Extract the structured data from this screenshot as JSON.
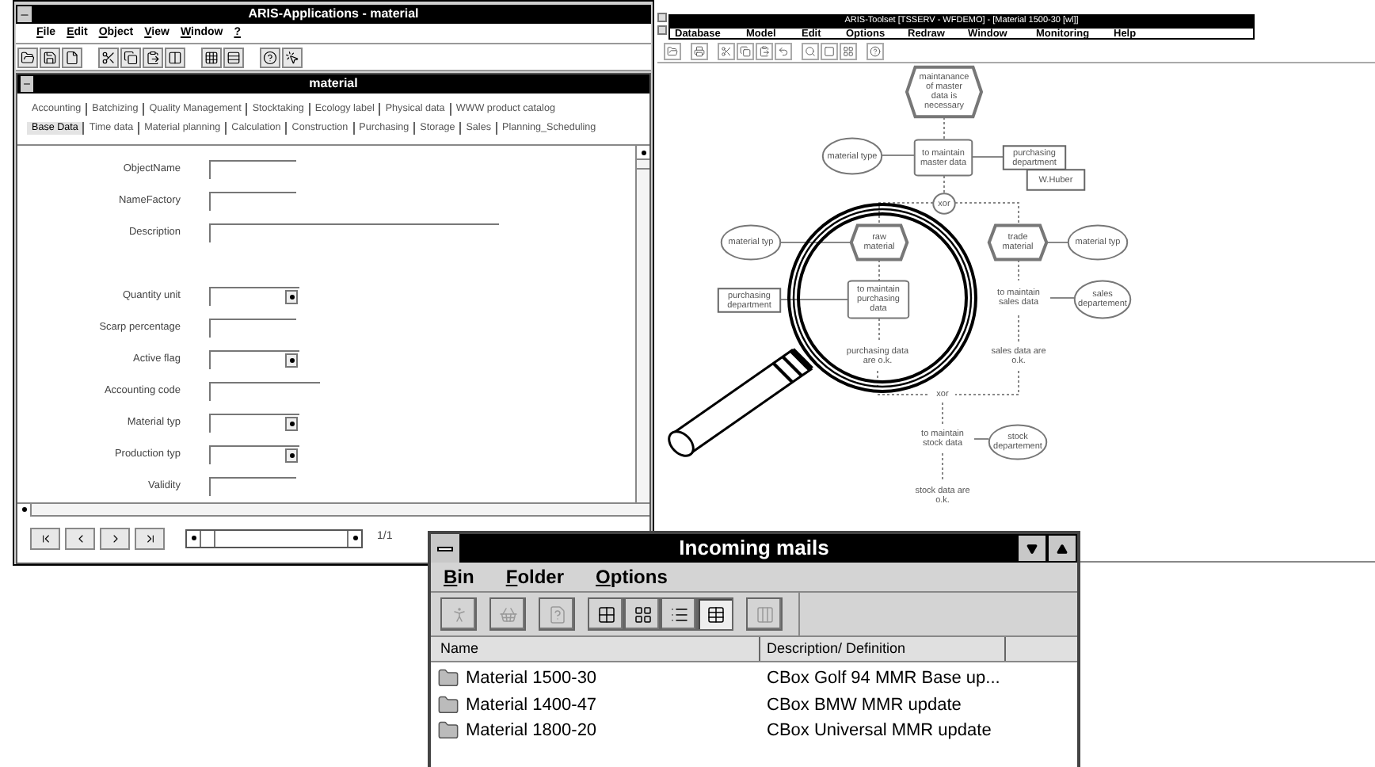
{
  "left_window": {
    "title": "ARIS-Applications - material",
    "menu": [
      "File",
      "Edit",
      "Object",
      "View",
      "Window",
      "?"
    ],
    "document": {
      "title": "material",
      "tab_rows": [
        [
          {
            "label": "Accounting",
            "selected": false
          },
          {
            "label": "Batchizing",
            "selected": false
          },
          {
            "label": "Quality Management",
            "selected": false
          },
          {
            "label": "Stocktaking",
            "selected": false
          },
          {
            "label": "Ecology label",
            "selected": false
          },
          {
            "label": "Physical data",
            "selected": false
          },
          {
            "label": "WWW product catalog",
            "selected": false
          }
        ],
        [
          {
            "label": "Base Data",
            "selected": true
          },
          {
            "label": "Time data",
            "selected": false
          },
          {
            "label": "Material planning",
            "selected": false
          },
          {
            "label": "Calculation",
            "selected": false
          },
          {
            "label": "Construction",
            "selected": false
          },
          {
            "label": "Purchasing",
            "selected": false
          },
          {
            "label": "Storage",
            "selected": false
          },
          {
            "label": "Sales",
            "selected": false
          },
          {
            "label": "Planning_Scheduling",
            "selected": false
          }
        ]
      ],
      "fields": [
        {
          "label": "ObjectName",
          "kind": "short"
        },
        {
          "label": "NameFactory",
          "kind": "short"
        },
        {
          "label": "Description",
          "kind": "long"
        },
        {
          "label": "Quantity unit",
          "kind": "select"
        },
        {
          "label": "Scarp percentage",
          "kind": "short"
        },
        {
          "label": "Active flag",
          "kind": "select"
        },
        {
          "label": "Accounting code",
          "kind": "medium"
        },
        {
          "label": "Material typ",
          "kind": "select"
        },
        {
          "label": "Production typ",
          "kind": "select"
        },
        {
          "label": "Validity",
          "kind": "short"
        }
      ],
      "pager": "1/1"
    }
  },
  "right_window": {
    "title": "ARIS-Toolset [TSSERV - WFDEMO] - [Material 1500-30 [wl]]",
    "menu": [
      "Database",
      "Model",
      "Edit",
      "Options",
      "Redraw",
      "Window",
      "Monitoring",
      "Help"
    ],
    "diagram": {
      "nodes": [
        {
          "kind": "event",
          "text": "maintanance of master data is necessary"
        },
        {
          "kind": "entity",
          "text": "material type"
        },
        {
          "kind": "function",
          "text": "to maintain master data"
        },
        {
          "kind": "org",
          "text": "purchasing department"
        },
        {
          "kind": "org",
          "text": "W.Huber"
        },
        {
          "kind": "xor",
          "text": "xor"
        },
        {
          "kind": "entity",
          "text": "material typ"
        },
        {
          "kind": "event",
          "text": "raw material"
        },
        {
          "kind": "event",
          "text": "trade material"
        },
        {
          "kind": "entity",
          "text": "material typ"
        },
        {
          "kind": "org",
          "text": "purchasing department"
        },
        {
          "kind": "function",
          "text": "to maintain purchasing data"
        },
        {
          "kind": "text",
          "text": "to maintain sales data"
        },
        {
          "kind": "entity",
          "text": "sales departement"
        },
        {
          "kind": "text",
          "text": "purchasing data are o.k."
        },
        {
          "kind": "text",
          "text": "sales data are o.k."
        },
        {
          "kind": "text",
          "text": "xor"
        },
        {
          "kind": "text",
          "text": "to maintain stock data"
        },
        {
          "kind": "entity",
          "text": "stock departement"
        },
        {
          "kind": "text",
          "text": "stock data are o.k."
        }
      ]
    }
  },
  "mail_window": {
    "title": "Incoming mails",
    "menu": [
      "Bin",
      "Folder",
      "Options"
    ],
    "toolbar": [
      {
        "disabled": true,
        "selected": false
      },
      {
        "disabled": true,
        "selected": false
      },
      {
        "disabled": true,
        "selected": false
      },
      {
        "disabled": false,
        "selected": false
      },
      {
        "disabled": false,
        "selected": false
      },
      {
        "disabled": false,
        "selected": false
      },
      {
        "disabled": false,
        "selected": true
      },
      {
        "disabled": true,
        "selected": false
      }
    ],
    "columns": [
      "Name",
      "Description/ Definition"
    ],
    "rows": [
      {
        "name": "Material 1500-30",
        "description": "CBox Golf 94 MMR Base up..."
      },
      {
        "name": "Material 1400-47",
        "description": "CBox BMW MMR update"
      },
      {
        "name": "Material 1800-20",
        "description": "CBox Universal MMR update"
      }
    ]
  }
}
